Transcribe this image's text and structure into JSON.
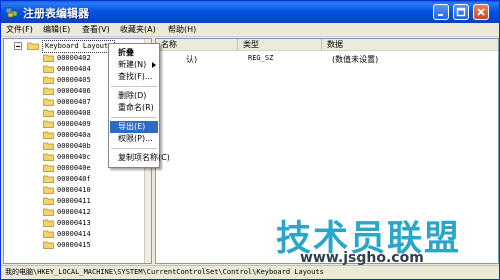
{
  "window": {
    "title": "注册表编辑器",
    "colors": {
      "titlebar": "#0454e0",
      "highlight": "#316ac5",
      "watermark": "#2aa7c8"
    }
  },
  "menubar": {
    "items": [
      "文件(F)",
      "编辑(E)",
      "查看(V)",
      "收藏夹(A)",
      "帮助(H)"
    ]
  },
  "tree": {
    "root_label": "Keyboard Layouts",
    "root_expander": "minus",
    "children": [
      "00000402",
      "00000404",
      "00000405",
      "00000406",
      "00000407",
      "00000408",
      "00000409",
      "0000040a",
      "0000040b",
      "0000040c",
      "0000040e",
      "0000040f",
      "00000410",
      "00000411",
      "00000412",
      "00000413",
      "00000414",
      "00000415"
    ]
  },
  "list": {
    "headers": {
      "name": "名称",
      "type": "类型",
      "data": "数据"
    },
    "rows": [
      {
        "name": "认)",
        "type": "REG_SZ",
        "data": "(数值未设置)"
      }
    ]
  },
  "context_menu": {
    "items": [
      {
        "label": "折叠",
        "bold": true,
        "submenu": false
      },
      {
        "label": "新建(N)",
        "bold": false,
        "submenu": true
      },
      {
        "label": "查找(F)...",
        "bold": false,
        "submenu": false
      },
      {
        "label": "删除(D)",
        "bold": false,
        "submenu": false
      },
      {
        "label": "重命名(R)",
        "bold": false,
        "submenu": false
      },
      {
        "label": "导出(E)",
        "bold": false,
        "submenu": false,
        "highlighted": true
      },
      {
        "label": "权限(P)...",
        "bold": false,
        "submenu": false
      },
      {
        "label": "复制项名称(C)",
        "bold": false,
        "submenu": false
      }
    ]
  },
  "statusbar": {
    "path": "我的电脑\\HKEY_LOCAL_MACHINE\\SYSTEM\\CurrentControlSet\\Control\\Keyboard Layouts"
  },
  "watermark": {
    "title": "技术员联盟",
    "url": "www.jsgho.com"
  }
}
